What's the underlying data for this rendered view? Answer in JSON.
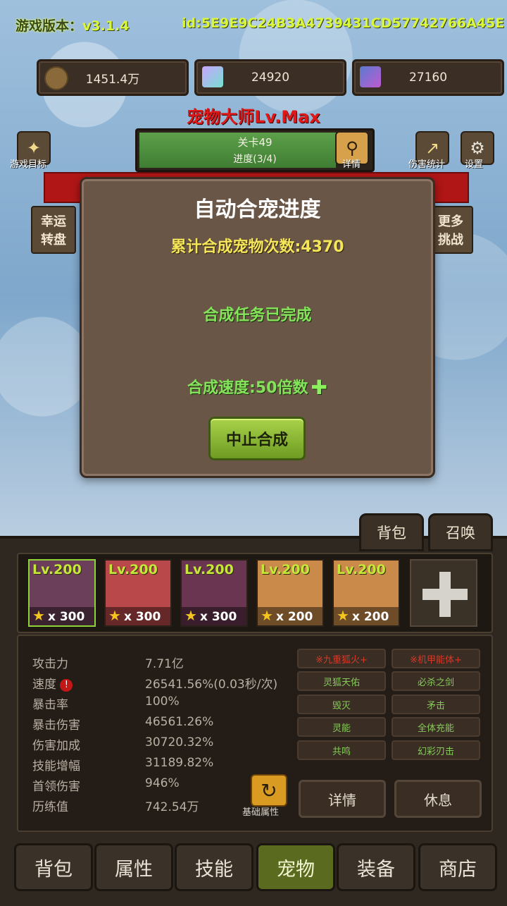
{
  "header": {
    "version_label": "游戏版本：",
    "version_value": "v3.1.4",
    "id_text": "id:5E9E9C24B3A4739431CD57742766A45E"
  },
  "resources": [
    {
      "icon": "coin-icon",
      "value": "1451.4万"
    },
    {
      "icon": "crystal-icon",
      "value": "24920"
    },
    {
      "icon": "card-icon",
      "value": "27160"
    }
  ],
  "player_title": "宠物大师Lv.Max",
  "stage": {
    "name": "关卡49",
    "progress": "进度(3/4)",
    "progress_fraction": 0.85
  },
  "buttons": {
    "game_goal": "游戏目标",
    "details": "详情",
    "damage_stats": "伤害统计",
    "settings": "设置",
    "lucky_wheel": [
      "幸运",
      "转盘"
    ],
    "more_challenge": [
      "更多",
      "挑战"
    ]
  },
  "modal": {
    "title": "自动合宠进度",
    "count_text": "累计合成宠物次数:4370",
    "done_text": "合成任务已完成",
    "speed_text": "合成速度:50倍数",
    "stop_button": "中止合成"
  },
  "panel_tabs": {
    "backpack": "背包",
    "summon": "召唤"
  },
  "pets": [
    {
      "level": "Lv.200",
      "count": "x 300",
      "color": "#6b3f5a",
      "border": "#8fd23a"
    },
    {
      "level": "Lv.200",
      "count": "x 300",
      "color": "#b8484a",
      "border": "#2a2018"
    },
    {
      "level": "Lv.200",
      "count": "x 300",
      "color": "#6a3550",
      "border": "#2a2018"
    },
    {
      "level": "Lv.200",
      "count": "x 200",
      "color": "#c98a4a",
      "border": "#2a2018"
    },
    {
      "level": "Lv.200",
      "count": "x 200",
      "color": "#c98a4a",
      "border": "#2a2018"
    }
  ],
  "stats": [
    {
      "label": "攻击力",
      "value": "7.71亿"
    },
    {
      "label": "速度",
      "value": "26541.56%(0.03秒/次)"
    },
    {
      "label": "暴击率",
      "value": "100%"
    },
    {
      "label": "暴击伤害",
      "value": "46561.26%"
    },
    {
      "label": "伤害加成",
      "value": "30720.32%"
    },
    {
      "label": "技能增幅",
      "value": "31189.82%"
    },
    {
      "label": "首领伤害",
      "value": "946%"
    },
    {
      "label": "历练值",
      "value": "742.54万"
    }
  ],
  "warn_mark": "!",
  "skills": [
    {
      "label": "※九重狐火+",
      "style": "red"
    },
    {
      "label": "※机甲能体+",
      "style": "red"
    },
    {
      "label": "灵狐天佑",
      "style": "green"
    },
    {
      "label": "必杀之剑",
      "style": "green"
    },
    {
      "label": "毁灭",
      "style": "green"
    },
    {
      "label": "矛击",
      "style": "green"
    },
    {
      "label": "灵能",
      "style": "green"
    },
    {
      "label": "全体充能",
      "style": "green"
    },
    {
      "label": "共鸣",
      "style": "green"
    },
    {
      "label": "幻彩刃击",
      "style": "green"
    }
  ],
  "basic_attr": "基础属性",
  "detail_button": "详情",
  "rest_button": "休息",
  "nav": [
    "背包",
    "属性",
    "技能",
    "宠物",
    "装备",
    "商店"
  ],
  "nav_active": "宠物"
}
